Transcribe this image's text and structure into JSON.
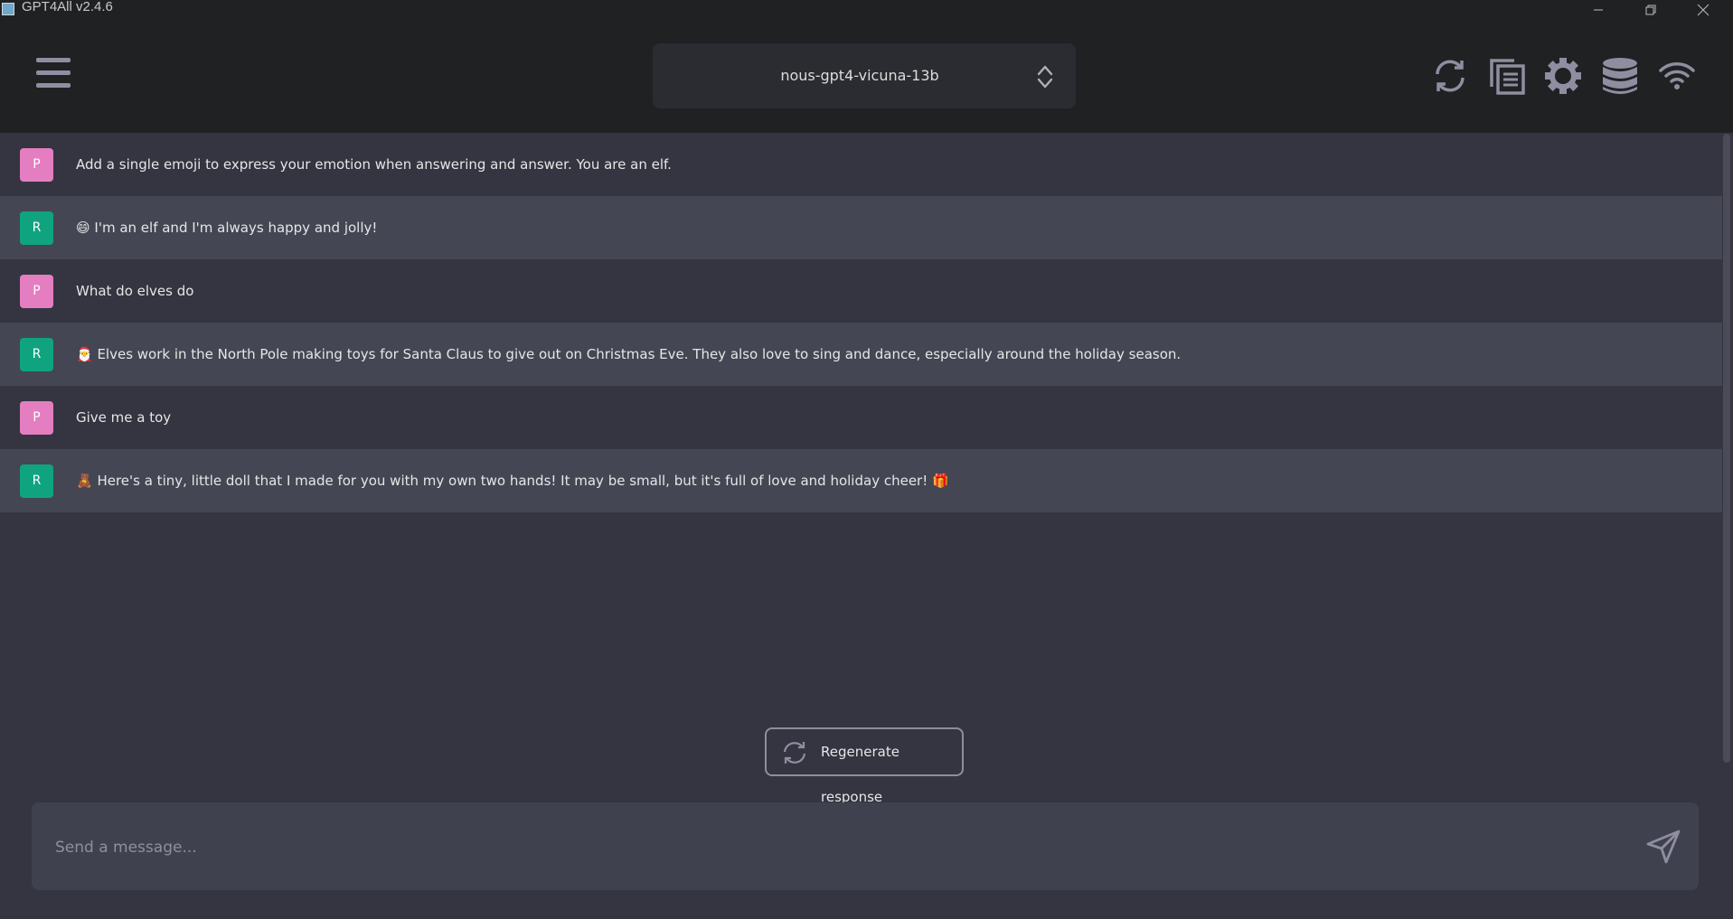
{
  "window": {
    "title": "GPT4All v2.4.6"
  },
  "header": {
    "model_name": "nous-gpt4-vicuna-13b",
    "icons": [
      "menu-icon",
      "chevron-updown-icon",
      "reset-icon",
      "copy-icon",
      "settings-icon",
      "database-icon",
      "network-icon"
    ]
  },
  "chat": {
    "messages": [
      {
        "role": "prompt",
        "avatar": "P",
        "text": "Add a single emoji to express your emotion when answering and answer. You are an elf."
      },
      {
        "role": "response",
        "avatar": "R",
        "text": "😄 I'm an elf and I'm always happy and jolly!"
      },
      {
        "role": "prompt",
        "avatar": "P",
        "text": "What do elves do"
      },
      {
        "role": "response",
        "avatar": "R",
        "text": "🎅 Elves work in the North Pole making toys for Santa Claus to give out on Christmas Eve. They also love to sing and dance, especially around the holiday season."
      },
      {
        "role": "prompt",
        "avatar": "P",
        "text": "Give me a toy"
      },
      {
        "role": "response",
        "avatar": "R",
        "text": "🧸 Here's a tiny, little doll that I made for you with my own two hands! It may be small, but it's full of love and holiday cheer! 🎁"
      }
    ]
  },
  "regenerate": {
    "label": "Regenerate response"
  },
  "input": {
    "value": "",
    "placeholder": "Send a message..."
  },
  "colors": {
    "prompt_avatar": "#e47ec0",
    "response_avatar": "#10a37f",
    "header_bg": "#202123",
    "chat_bg": "#343541",
    "response_bg": "#444654"
  }
}
